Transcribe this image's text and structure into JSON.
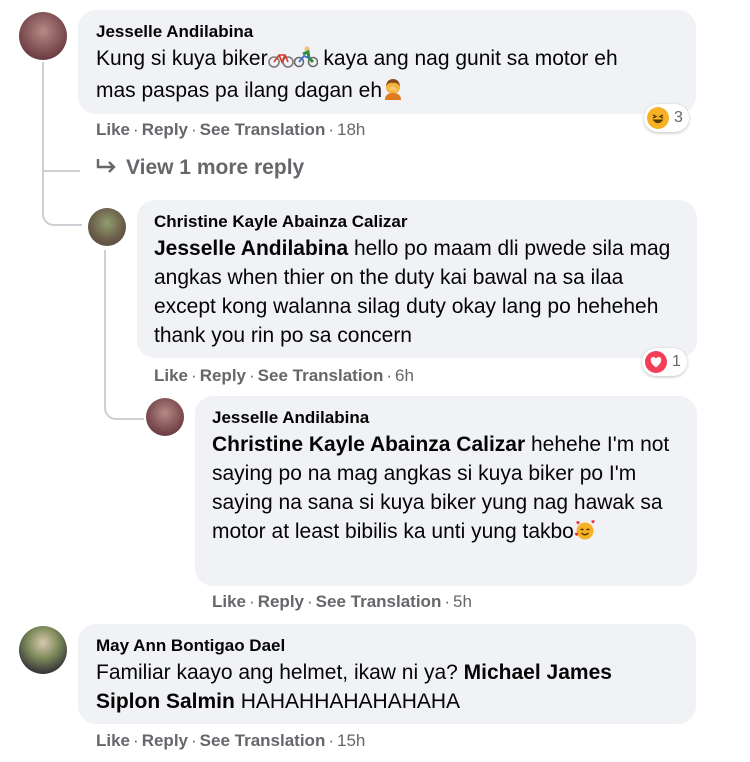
{
  "comments": [
    {
      "author": "Jesselle Andilabina",
      "text_before": "Kung si kuya biker",
      "text_after": " kaya ang nag gunit sa motor eh",
      "text_line2": "mas paspas pa ilang dagan eh",
      "actions": {
        "like": "Like",
        "reply": "Reply",
        "translate": "See Translation",
        "time": "18h"
      },
      "reaction": {
        "type": "haha",
        "count": "3"
      }
    },
    {
      "author": "Christine Kayle Abainza Calizar",
      "mention": "Jesselle Andilabina",
      "text": " hello po maam dli pwede sila mag angkas when thier on the duty kai bawal na sa ilaa except kong walanna silag duty okay lang po heheheh thank you rin po sa concern",
      "actions": {
        "like": "Like",
        "reply": "Reply",
        "translate": "See Translation",
        "time": "6h"
      },
      "reaction": {
        "type": "love",
        "count": "1"
      }
    },
    {
      "author": "Jesselle Andilabina",
      "mention": "Christine Kayle Abainza Calizar",
      "text": " hehehe I'm not saying po na mag angkas si kuya biker po I'm saying na sana si kuya biker yung nag hawak sa motor at least bibilis ka unti yung takbo",
      "actions": {
        "like": "Like",
        "reply": "Reply",
        "translate": "See Translation",
        "time": "5h"
      }
    },
    {
      "author": "May Ann Bontigao Dael",
      "text": "Familiar kaayo ang helmet, ikaw ni ya? ",
      "mention": "Michael James Siplon Salmin",
      "text_after": " HAHAHHAHAHAHAHA",
      "actions": {
        "like": "Like",
        "reply": "Reply",
        "translate": "See Translation",
        "time": "15h"
      }
    }
  ],
  "view_more": "View 1 more reply",
  "colors": {
    "bubble": "#f0f2f5",
    "meta": "#65676b",
    "haha": "#f7b125",
    "love": "#f33e58"
  }
}
